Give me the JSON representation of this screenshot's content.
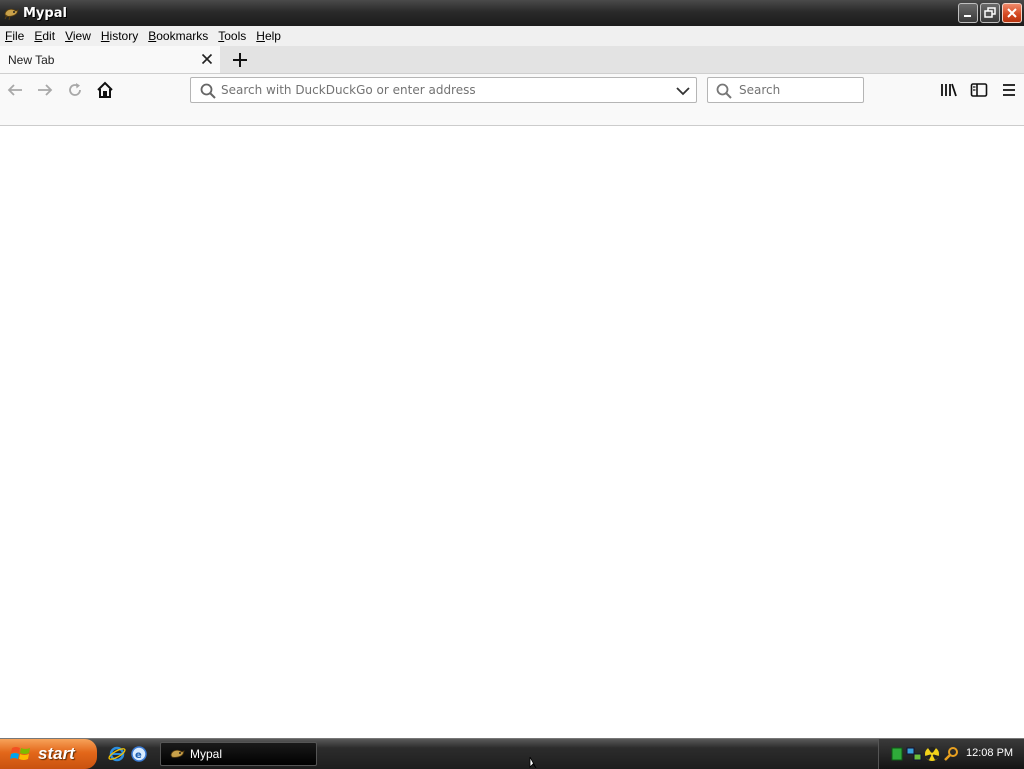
{
  "window": {
    "title": "Mypal",
    "app_icon": "mypal-icon",
    "controls": [
      "minimize-icon",
      "restore-icon",
      "close-icon"
    ]
  },
  "menubar": {
    "items": [
      {
        "label": "File",
        "mnemonic": "F",
        "rest": "ile"
      },
      {
        "label": "Edit",
        "mnemonic": "E",
        "rest": "dit"
      },
      {
        "label": "View",
        "mnemonic": "V",
        "rest": "iew"
      },
      {
        "label": "History",
        "mnemonic": "H",
        "rest": "istory"
      },
      {
        "label": "Bookmarks",
        "mnemonic": "B",
        "rest": "ookmarks"
      },
      {
        "label": "Tools",
        "mnemonic": "T",
        "rest": "ools"
      },
      {
        "label": "Help",
        "mnemonic": "H",
        "rest": "elp"
      }
    ]
  },
  "tabs": [
    {
      "label": "New Tab",
      "active": true
    }
  ],
  "navbar": {
    "back_icon": "back-arrow-icon",
    "forward_icon": "forward-arrow-icon",
    "reload_icon": "reload-icon",
    "home_icon": "home-icon",
    "urlbar": {
      "value": "",
      "placeholder": "Search with DuckDuckGo or enter address"
    },
    "searchbar": {
      "value": "",
      "placeholder": "Search"
    },
    "library_icon": "library-icon",
    "sidebar_icon": "sidebar-icon",
    "menu_icon": "hamburger-menu-icon"
  },
  "taskbar": {
    "start_label": "start",
    "quick_launch": [
      "internet-explorer-icon",
      "outlook-express-icon"
    ],
    "active_task": {
      "label": "Mypal"
    },
    "tray_icons": [
      "green-status-icon",
      "network-icon",
      "radiation-icon",
      "search-icon"
    ],
    "clock": "12:08 PM"
  },
  "colors": {
    "titlebar": "#2a2a2a",
    "start_button": "#e3671a",
    "close_button": "#d2461f",
    "toolbar": "#f9f9f9"
  }
}
